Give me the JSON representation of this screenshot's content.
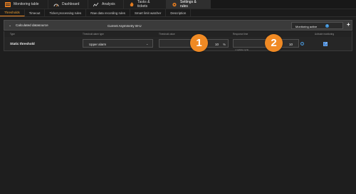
{
  "main_tabs": [
    {
      "label": "Monitoring table",
      "icon": "table-icon"
    },
    {
      "label": "Dashboard",
      "icon": "dashboard-icon"
    },
    {
      "label": "Analysis",
      "icon": "chart-icon"
    },
    {
      "label": "Tasks & tickets",
      "icon": "fire-icon"
    },
    {
      "label": "Settings & rules",
      "icon": "settings-icon",
      "active": true
    }
  ],
  "sub_tabs": [
    {
      "label": "Thresholds",
      "active": true
    },
    {
      "label": "Timeout"
    },
    {
      "label": "Ticket processing rules"
    },
    {
      "label": "Raw data recording rules"
    },
    {
      "label": "Smart limit watcher"
    },
    {
      "label": "Description"
    }
  ],
  "panel": {
    "collapse_glyph": "⌄",
    "title": "Calculated datasource",
    "current": "Current Asymmetry W-U",
    "monitoring_label": "Monitoring active",
    "add_glyph": "+"
  },
  "columns": {
    "type": "Type",
    "alarm_type": "Threshold alarm type",
    "threshold": "Threshold value",
    "response": "Response time",
    "active": "Activate monitoring"
  },
  "row": {
    "type": "Static threshold",
    "alarm": "Upper alarm",
    "threshold_value": "10",
    "threshold_unit": "%",
    "response_value": "10",
    "cycle_label": "x update cycle",
    "monitoring_checked": true
  },
  "badges": [
    "1",
    "2"
  ],
  "colors": {
    "accent": "#f08a24",
    "info": "#3a8fd6",
    "background": "#1e1e1e"
  }
}
